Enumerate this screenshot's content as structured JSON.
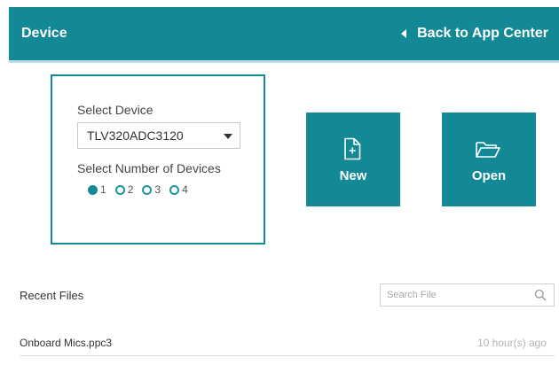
{
  "header": {
    "title": "Device",
    "back_label": "Back to App Center",
    "color": "#138995"
  },
  "device_panel": {
    "select_label": "Select Device",
    "selected_device": "TLV320ADC3120",
    "count_label": "Select Number of Devices",
    "options": [
      "1",
      "2",
      "3",
      "4"
    ],
    "selected_count": "1"
  },
  "tiles": {
    "new_label": "New",
    "new_icon": "new-file-icon",
    "open_label": "Open",
    "open_icon": "folder-open-icon"
  },
  "recent": {
    "title": "Recent Files",
    "search_placeholder": "Search File",
    "files": [
      {
        "name": "Onboard Mics.ppc3",
        "time": "10 hour(s) ago"
      }
    ]
  }
}
